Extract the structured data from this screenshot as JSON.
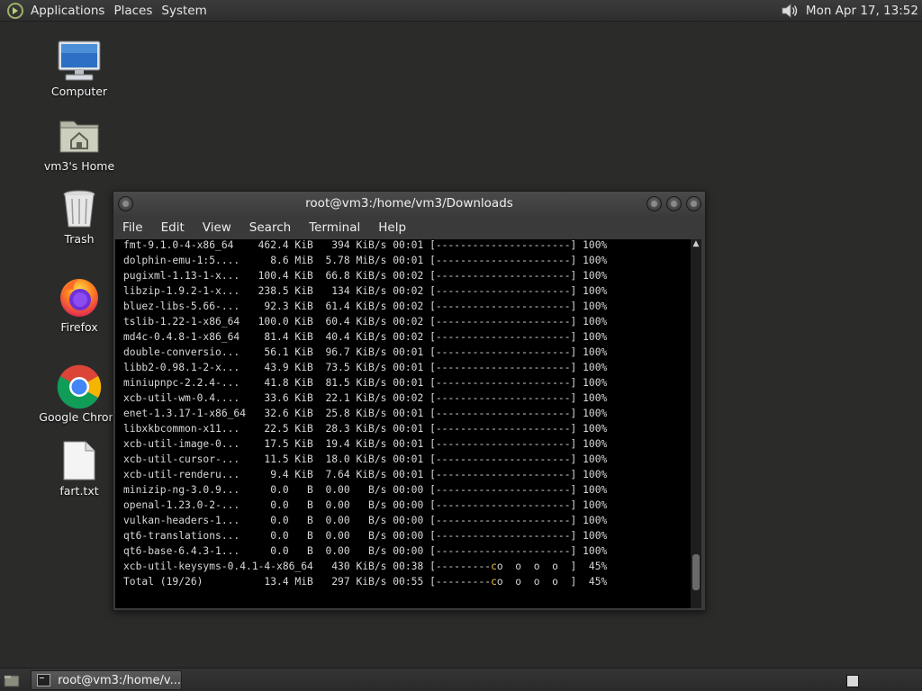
{
  "top_panel": {
    "menus": [
      "Applications",
      "Places",
      "System"
    ],
    "clock": "Mon Apr 17, 13:52"
  },
  "desktop_icons": [
    {
      "label": "Computer",
      "icon": "computer-icon"
    },
    {
      "label": "vm3's Home",
      "icon": "home-folder-icon"
    },
    {
      "label": "Trash",
      "icon": "trash-icon"
    },
    {
      "label": "Firefox",
      "icon": "firefox-icon"
    },
    {
      "label": "Google Chrom",
      "icon": "chrome-icon"
    },
    {
      "label": "fart.txt",
      "icon": "text-file-icon"
    }
  ],
  "terminal": {
    "title": "root@vm3:/home/vm3/Downloads",
    "menu": [
      "File",
      "Edit",
      "View",
      "Search",
      "Terminal",
      "Help"
    ],
    "lines": [
      "fmt-9.1.0-4-x86_64    462.4 KiB   394 KiB/s 00:01 [----------------------] 100%",
      "dolphin-emu-1:5....     8.6 MiB  5.78 MiB/s 00:01 [----------------------] 100%",
      "pugixml-1.13-1-x...   100.4 KiB  66.8 KiB/s 00:02 [----------------------] 100%",
      "libzip-1.9.2-1-x...   238.5 KiB   134 KiB/s 00:02 [----------------------] 100%",
      "bluez-libs-5.66-...    92.3 KiB  61.4 KiB/s 00:02 [----------------------] 100%",
      "tslib-1.22-1-x86_64   100.0 KiB  60.4 KiB/s 00:02 [----------------------] 100%",
      "md4c-0.4.8-1-x86_64    81.4 KiB  40.4 KiB/s 00:02 [----------------------] 100%",
      "double-conversio...    56.1 KiB  96.7 KiB/s 00:01 [----------------------] 100%",
      "libb2-0.98.1-2-x...    43.9 KiB  73.5 KiB/s 00:01 [----------------------] 100%",
      "miniupnpc-2.2.4-...    41.8 KiB  81.5 KiB/s 00:01 [----------------------] 100%",
      "xcb-util-wm-0.4....    33.6 KiB  22.1 KiB/s 00:02 [----------------------] 100%",
      "enet-1.3.17-1-x86_64   32.6 KiB  25.8 KiB/s 00:01 [----------------------] 100%",
      "libxkbcommon-x11...    22.5 KiB  28.3 KiB/s 00:01 [----------------------] 100%",
      "xcb-util-image-0...    17.5 KiB  19.4 KiB/s 00:01 [----------------------] 100%",
      "xcb-util-cursor-...    11.5 KiB  18.0 KiB/s 00:01 [----------------------] 100%",
      "xcb-util-renderu...     9.4 KiB  7.64 KiB/s 00:01 [----------------------] 100%",
      "minizip-ng-3.0.9...     0.0   B  0.00   B/s 00:00 [----------------------] 100%",
      "openal-1.23.0-2-...     0.0   B  0.00   B/s 00:00 [----------------------] 100%",
      "vulkan-headers-1...     0.0   B  0.00   B/s 00:00 [----------------------] 100%",
      "qt6-translations...     0.0   B  0.00   B/s 00:00 [----------------------] 100%",
      "qt6-base-6.4.3-1...     0.0   B  0.00   B/s 00:00 [----------------------] 100%"
    ],
    "progress_lines": [
      {
        "prefix": "xcb-util-keysyms-0.4.1-4-x86_64   430 KiB/s 00:38 [---------",
        "pac": "c",
        "suffix": "o  o  o  o  ]  45%"
      },
      {
        "prefix": "Total (19/26)          13.4 MiB   297 KiB/s 00:55 [---------",
        "pac": "c",
        "suffix": "o  o  o  o  ]  45%"
      }
    ]
  },
  "taskbar": {
    "window_button": "root@vm3:/home/v..."
  }
}
